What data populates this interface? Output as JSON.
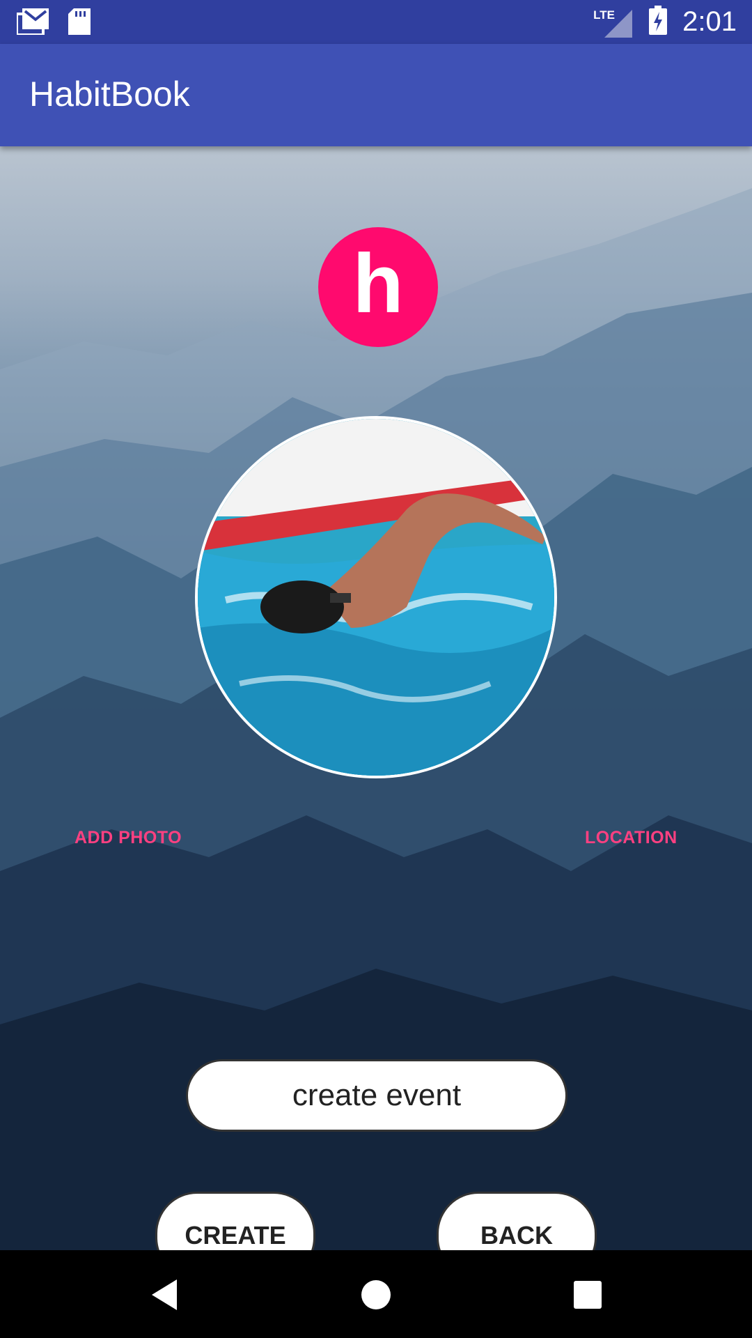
{
  "status_bar": {
    "time": "2:01",
    "network": "LTE",
    "icons": [
      "gmail-icon",
      "sd-card-icon",
      "signal-icon",
      "battery-charging-icon"
    ]
  },
  "app_bar": {
    "title": "HabitBook"
  },
  "logo": {
    "letter": "h",
    "color": "#ff0a6e"
  },
  "photo": {
    "icon": "swimmer-photo"
  },
  "actions": {
    "add_photo_label": "ADD PHOTO",
    "location_label": "LOCATION"
  },
  "event_field": {
    "value": "create event"
  },
  "buttons": {
    "create_label": "CREATE",
    "back_label": "BACK"
  },
  "nav_bar": {
    "icons": [
      "back-icon",
      "home-icon",
      "recents-icon"
    ]
  },
  "colors": {
    "primary": "#3f51b5",
    "primary_dark": "#303f9f",
    "accent": "#ff4081"
  }
}
